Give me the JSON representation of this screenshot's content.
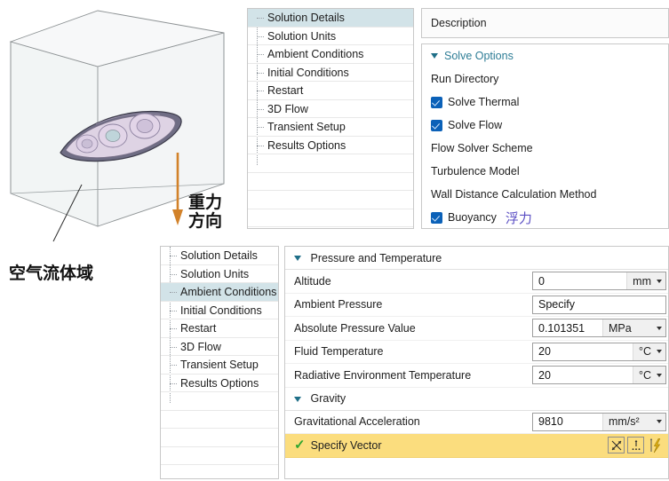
{
  "viewport": {
    "gravity_label": "重力\n方向",
    "gravity_label_line1": "重力",
    "gravity_label_line2": "方向",
    "domain_label": "空气流体域",
    "arrow_color": "#d2822a",
    "cube_face_color": "#eef1f2"
  },
  "top_tree": {
    "items": [
      {
        "label": "Solution Details",
        "selected": true
      },
      {
        "label": "Solution Units",
        "selected": false
      },
      {
        "label": "Ambient Conditions",
        "selected": false
      },
      {
        "label": "Initial Conditions",
        "selected": false
      },
      {
        "label": "Restart",
        "selected": false
      },
      {
        "label": "3D Flow",
        "selected": false
      },
      {
        "label": "Transient Setup",
        "selected": false
      },
      {
        "label": "Results Options",
        "selected": false
      }
    ]
  },
  "description_panel": {
    "header": "Description"
  },
  "solve_options": {
    "group_title": "Solve Options",
    "rows": [
      {
        "label": "Run Directory",
        "checkbox": false
      },
      {
        "label": "Solve Thermal",
        "checkbox": true
      },
      {
        "label": "Solve Flow",
        "checkbox": true
      },
      {
        "label": "Flow Solver Scheme",
        "checkbox": false
      },
      {
        "label": "Turbulence Model",
        "checkbox": false
      },
      {
        "label": "Wall Distance Calculation Method",
        "checkbox": false
      },
      {
        "label": "Buoyancy",
        "checkbox": true,
        "note": "浮力"
      }
    ]
  },
  "bottom_tree": {
    "items": [
      {
        "label": "Solution Details",
        "selected": false
      },
      {
        "label": "Solution Units",
        "selected": false
      },
      {
        "label": "Ambient Conditions",
        "selected": true
      },
      {
        "label": "Initial Conditions",
        "selected": false
      },
      {
        "label": "Restart",
        "selected": false
      },
      {
        "label": "3D Flow",
        "selected": false
      },
      {
        "label": "Transient Setup",
        "selected": false
      },
      {
        "label": "Results Options",
        "selected": false
      }
    ]
  },
  "ambient_conditions": {
    "pressure_group_title": "Pressure and Temperature",
    "gravity_group_title": "Gravity",
    "rows": [
      {
        "label": "Altitude",
        "value": "0",
        "unit": "mm",
        "has_caret": true,
        "unit_wide": false
      },
      {
        "label": "Ambient Pressure",
        "value": "Specify",
        "unit": "",
        "has_caret": false,
        "unit_wide": false
      },
      {
        "label": "Absolute Pressure Value",
        "value": "0.101351",
        "unit": "MPa",
        "has_caret": true,
        "unit_wide": true
      },
      {
        "label": "Fluid Temperature",
        "value": "20",
        "unit": "°C",
        "has_caret": true,
        "unit_wide": false
      },
      {
        "label": "Radiative Environment Temperature",
        "value": "20",
        "unit": "°C",
        "has_caret": true,
        "unit_wide": false
      }
    ],
    "gravity_rows": [
      {
        "label": "Gravitational Acceleration",
        "value": "9810",
        "unit": "mm/s²",
        "has_caret": true,
        "unit_wide": true
      }
    ],
    "specify_vector": {
      "label": "Specify Vector",
      "check_glyph": "✓",
      "highlight_color": "#fbdd7e"
    }
  }
}
